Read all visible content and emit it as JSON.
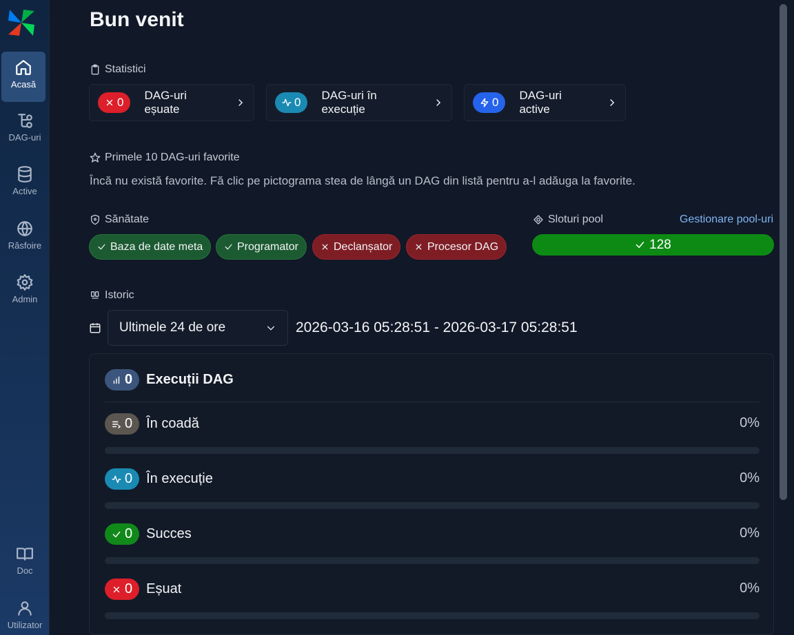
{
  "sidebar": {
    "items": [
      {
        "label": "Acasă",
        "icon": "home-icon"
      },
      {
        "label": "DAG-uri",
        "icon": "dags-icon"
      },
      {
        "label": "Active",
        "icon": "database-icon"
      },
      {
        "label": "Răsfoire",
        "icon": "globe-icon"
      },
      {
        "label": "Admin",
        "icon": "gear-icon"
      },
      {
        "label": "Doc",
        "icon": "book-icon"
      },
      {
        "label": "Utilizator",
        "icon": "user-icon"
      }
    ]
  },
  "page": {
    "title": "Bun venit"
  },
  "stats": {
    "label": "Statistici",
    "cards": [
      {
        "count": "0",
        "label": "DAG-uri eșuate",
        "icon": "x-icon",
        "color": "#dc1f2a"
      },
      {
        "count": "0",
        "label": "DAG-uri în execuție",
        "icon": "activity-icon",
        "color": "#1a8ab3"
      },
      {
        "count": "0",
        "label": "DAG-uri active",
        "icon": "bolt-icon",
        "color": "#2563eb"
      }
    ]
  },
  "favorites": {
    "label": "Primele 10 DAG-uri favorite",
    "empty_text": "Încă nu există favorite. Fă clic pe pictograma stea de lângă un DAG din listă pentru a-l adăuga la favorite."
  },
  "health": {
    "label": "Sănătate",
    "items": [
      {
        "label": "Baza de date meta",
        "status": "ok"
      },
      {
        "label": "Programator",
        "status": "ok"
      },
      {
        "label": "Declanșator",
        "status": "error"
      },
      {
        "label": "Procesor DAG",
        "status": "error"
      }
    ]
  },
  "pool": {
    "label": "Sloturi pool",
    "manage_link": "Gestionare pool-uri",
    "open_slots": "128",
    "bar_color": "#0d8a14"
  },
  "history": {
    "label": "Istoric",
    "range_select": "Ultimele 24 de ore",
    "range_text": "2026-03-16 05:28:51 - 2026-03-17 05:28:51",
    "runs": {
      "title": "Execuții DAG",
      "total": "0",
      "rows": [
        {
          "label": "În coadă",
          "count": "0",
          "percent": "0%",
          "fraction": 0,
          "icon": "queue-icon",
          "color": "#5b5650"
        },
        {
          "label": "În execuție",
          "count": "0",
          "percent": "0%",
          "fraction": 0,
          "icon": "activity-icon",
          "color": "#1a8ab3"
        },
        {
          "label": "Succes",
          "count": "0",
          "percent": "0%",
          "fraction": 0,
          "icon": "check-icon",
          "color": "#11891a"
        },
        {
          "label": "Eșuat",
          "count": "0",
          "percent": "0%",
          "fraction": 0,
          "icon": "x-icon",
          "color": "#dc1f2a"
        }
      ]
    }
  }
}
